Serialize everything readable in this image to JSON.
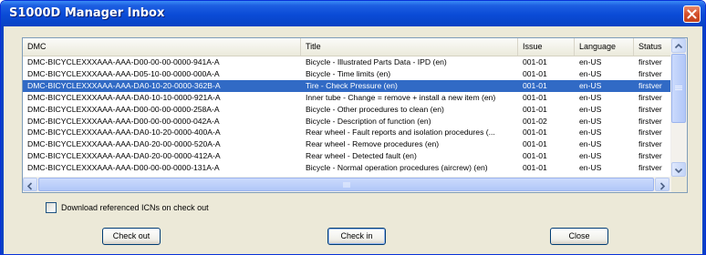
{
  "window": {
    "title": "S1000D Manager Inbox"
  },
  "table": {
    "columns": [
      "DMC",
      "Title",
      "Issue",
      "Language",
      "Status"
    ],
    "rows": [
      {
        "dmc": "DMC-BICYCLEXXXAAA-AAA-D00-00-00-0000-941A-A",
        "title": "Bicycle - Illustrated Parts Data - IPD (en)",
        "issue": "001-01",
        "language": "en-US",
        "status": "firstver"
      },
      {
        "dmc": "DMC-BICYCLEXXXAAA-AAA-D05-10-00-0000-000A-A",
        "title": "Bicycle - Time limits (en)",
        "issue": "001-01",
        "language": "en-US",
        "status": "firstver"
      },
      {
        "dmc": "DMC-BICYCLEXXXAAA-AAA-DA0-10-20-0000-362B-A",
        "title": "Tire - Check Pressure (en)",
        "issue": "001-01",
        "language": "en-US",
        "status": "firstver",
        "selected": true
      },
      {
        "dmc": "DMC-BICYCLEXXXAAA-AAA-DA0-10-10-0000-921A-A",
        "title": "Inner tube - Change = remove + install  a new item (en)",
        "issue": "001-01",
        "language": "en-US",
        "status": "firstver"
      },
      {
        "dmc": "DMC-BICYCLEXXXAAA-AAA-D00-00-00-0000-258A-A",
        "title": "Bicycle - Other procedures to clean (en)",
        "issue": "001-01",
        "language": "en-US",
        "status": "firstver"
      },
      {
        "dmc": "DMC-BICYCLEXXXAAA-AAA-D00-00-00-0000-042A-A",
        "title": "Bicycle - Description of function (en)",
        "issue": "001-02",
        "language": "en-US",
        "status": "firstver"
      },
      {
        "dmc": "DMC-BICYCLEXXXAAA-AAA-DA0-10-20-0000-400A-A",
        "title": "Rear wheel - Fault reports and isolation  procedures (...",
        "issue": "001-01",
        "language": "en-US",
        "status": "firstver"
      },
      {
        "dmc": "DMC-BICYCLEXXXAAA-AAA-DA0-20-00-0000-520A-A",
        "title": "Rear wheel - Remove procedures (en)",
        "issue": "001-01",
        "language": "en-US",
        "status": "firstver"
      },
      {
        "dmc": "DMC-BICYCLEXXXAAA-AAA-DA0-20-00-0000-412A-A",
        "title": "Rear wheel - Detected fault (en)",
        "issue": "001-01",
        "language": "en-US",
        "status": "firstver"
      },
      {
        "dmc": "DMC-BICYCLEXXXAAA-AAA-D00-00-00-0000-131A-A",
        "title": "Bicycle - Normal operation procedures  (aircrew) (en)",
        "issue": "001-01",
        "language": "en-US",
        "status": "firstver"
      }
    ]
  },
  "options": {
    "download_icns_label": "Download referenced ICNs on check out",
    "download_icns_checked": false
  },
  "buttons": {
    "check_out": "Check out",
    "check_in": "Check in",
    "close": "Close"
  },
  "colors": {
    "selection": "#316ac5",
    "titlebar": "#0a4bd6",
    "close_button": "#d4502b"
  }
}
